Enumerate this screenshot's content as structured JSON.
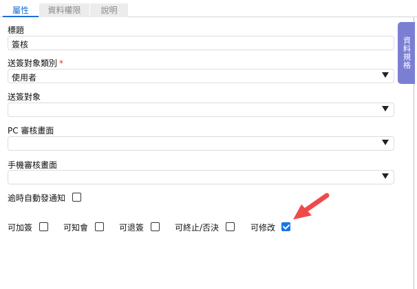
{
  "tabs": [
    {
      "label": "屬性",
      "active": true
    },
    {
      "label": "資料權限",
      "active": false
    },
    {
      "label": "說明",
      "active": false
    }
  ],
  "side_tab": {
    "label": "資料規格"
  },
  "form": {
    "title_label": "標題",
    "title_value": "簽核",
    "recipient_type_label": "送簽對象類別",
    "recipient_type_required": "*",
    "recipient_type_value": "使用者",
    "recipient_label": "送簽對象",
    "recipient_value": "",
    "pc_page_label": "PC 審核畫面",
    "pc_page_value": "",
    "mobile_page_label": "手機審核畫面",
    "mobile_page_value": "",
    "overdue_label": "逾時自動發通知",
    "overdue_checked": false
  },
  "options": [
    {
      "label": "可加簽",
      "checked": false
    },
    {
      "label": "可知會",
      "checked": false
    },
    {
      "label": "可退簽",
      "checked": false
    },
    {
      "label": "可終止/否決",
      "checked": false
    },
    {
      "label": "可修改",
      "checked": true
    }
  ],
  "colors": {
    "accent": "#1a6fd8",
    "side_tab": "#7b7fd4",
    "arrow": "#ef4a4a"
  },
  "icons": {
    "dropdown": "caret-down-icon",
    "annotation": "red-arrow-icon"
  }
}
